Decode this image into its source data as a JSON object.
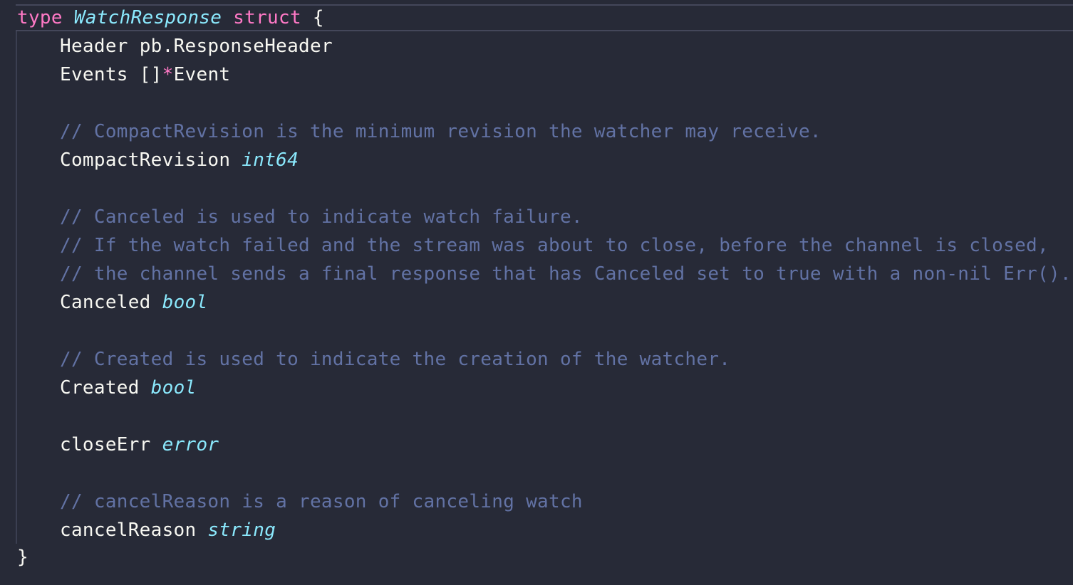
{
  "code": {
    "l1": {
      "kw_type": "type",
      "name": "WatchResponse",
      "kw_struct": "struct",
      "brace": "{"
    },
    "l2": {
      "field": "Header",
      "type": "pb.ResponseHeader"
    },
    "l3": {
      "field": "Events",
      "brackets": "[]",
      "ptr": "*",
      "type": "Event"
    },
    "l5": {
      "comment": "// CompactRevision is the minimum revision the watcher may receive."
    },
    "l6": {
      "field": "CompactRevision",
      "type": "int64"
    },
    "l8": {
      "comment": "// Canceled is used to indicate watch failure."
    },
    "l9": {
      "comment": "// If the watch failed and the stream was about to close, before the channel is closed,"
    },
    "l10": {
      "comment": "// the channel sends a final response that has Canceled set to true with a non-nil Err()."
    },
    "l11": {
      "field": "Canceled",
      "type": "bool"
    },
    "l13": {
      "comment": "// Created is used to indicate the creation of the watcher."
    },
    "l14": {
      "field": "Created",
      "type": "bool"
    },
    "l16": {
      "field": "closeErr",
      "type": "error"
    },
    "l18": {
      "comment": "// cancelReason is a reason of canceling watch"
    },
    "l19": {
      "field": "cancelReason",
      "type": "string"
    },
    "l20": {
      "brace": "}"
    }
  }
}
